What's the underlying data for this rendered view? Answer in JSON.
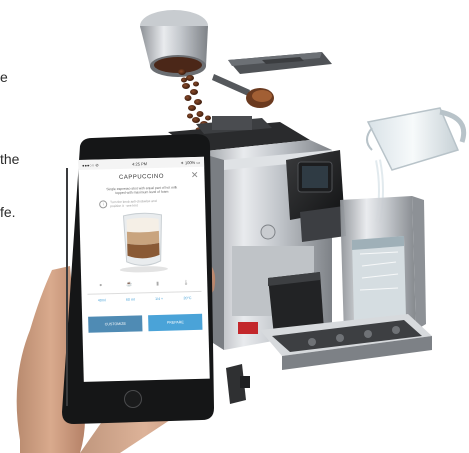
{
  "left_text_fragments": [
    "e",
    "the",
    "fe."
  ],
  "phone": {
    "status_bar": {
      "carrier": "●●●○○ ⊘",
      "time": "4:25 PM",
      "battery": "✶ 100% ▭"
    },
    "title": "CAPPUCCINO",
    "description_line1": "Single espresso shot with equal part of hot milk",
    "description_line2": "topped with maximum level of foam",
    "notice_line1": "Turn the knob anti-clockwise and",
    "notice_line2": "position it · see hint",
    "parameter_values": [
      "40ml",
      "60 ml",
      "1/4 +",
      "20°C"
    ],
    "buttons": {
      "customize": "CUSTOMIZE",
      "prepare": "PREPARE"
    }
  },
  "colors": {
    "accent": "#4aa3d8",
    "background": "#ffffff"
  },
  "icons": [
    "close-icon",
    "info-icon",
    "coffee-bean-icon",
    "cup-icon",
    "milk-icon",
    "temperature-icon"
  ]
}
